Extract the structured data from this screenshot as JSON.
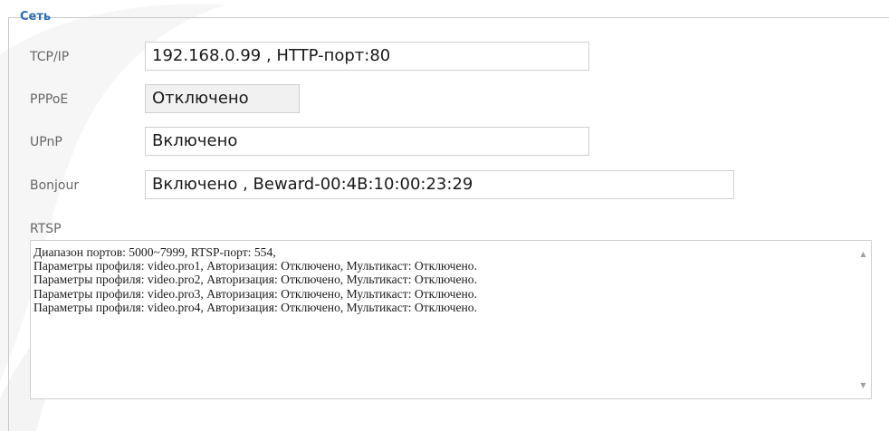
{
  "section": {
    "legend": "Сеть"
  },
  "rows": [
    {
      "label": "TCP/IP",
      "value": "192.168.0.99 , HTTP-порт:80"
    },
    {
      "label": "PPPoE",
      "value": "Отключено"
    },
    {
      "label": "UPnP",
      "value": "Включено"
    },
    {
      "label": "Bonjour",
      "value": "Включено , Beward-00:4B:10:00:23:29"
    }
  ],
  "rtsp": {
    "label": "RTSP",
    "text": "Диапазон портов: 5000~7999, RTSP-порт: 554,\nПараметры профиля: video.pro1, Авторизация: Отключено, Мультикаст: Отключено.\nПараметры профиля: video.pro2, Авторизация: Отключено, Мультикаст: Отключено.\nПараметры профиля: video.pro3, Авторизация: Отключено, Мультикаст: Отключено.\nПараметры профиля: video.pro4, Авторизация: Отключено, Мультикаст: Отключено."
  },
  "colors": {
    "legend": "#2e6fb3",
    "label": "#666666",
    "border": "#cfcfcf",
    "readonly_bg": "#f1f1f1"
  },
  "icons": {
    "scroll_up": "triangle-up-icon",
    "scroll_down": "triangle-down-icon"
  }
}
